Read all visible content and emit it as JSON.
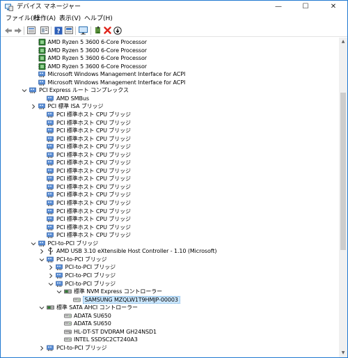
{
  "window": {
    "title": "デバイス マネージャー",
    "controls": {
      "minimize": "—",
      "maximize": "☐",
      "close": "✕"
    }
  },
  "menu": {
    "items": [
      "ファイル(F)",
      "操作(A)",
      "表示(V)",
      "ヘルプ(H)"
    ]
  },
  "toolbar": {
    "buttons": [
      "back-arrow-icon",
      "forward-arrow-icon",
      "device-view-icon",
      "properties-icon",
      "help-icon",
      "show-hidden-icon",
      "monitor-scan-icon",
      "add-driver-icon",
      "uninstall-icon",
      "disable-icon"
    ]
  },
  "tree": {
    "rows": [
      {
        "label": "AMD Ryzen 5 3600 6-Core Processor",
        "icon": "cpu-icon",
        "expander": "none",
        "depth": 3
      },
      {
        "label": "AMD Ryzen 5 3600 6-Core Processor",
        "icon": "cpu-icon",
        "expander": "none",
        "depth": 3
      },
      {
        "label": "AMD Ryzen 5 3600 6-Core Processor",
        "icon": "cpu-icon",
        "expander": "none",
        "depth": 3
      },
      {
        "label": "AMD Ryzen 5 3600 6-Core Processor",
        "icon": "cpu-icon",
        "expander": "none",
        "depth": 3
      },
      {
        "label": "Microsoft Windows Management Interface for ACPI",
        "icon": "system-device-icon",
        "expander": "none",
        "depth": 3
      },
      {
        "label": "Microsoft Windows Management Interface for ACPI",
        "icon": "system-device-icon",
        "expander": "none",
        "depth": 3
      },
      {
        "label": "PCI Express ルート コンプレックス",
        "icon": "system-device-icon",
        "expander": "open",
        "depth": 2
      },
      {
        "label": "AMD SMBus",
        "icon": "system-device-icon",
        "expander": "none",
        "depth": 4
      },
      {
        "label": "PCI 標準 ISA ブリッジ",
        "icon": "system-device-icon",
        "expander": "closed",
        "depth": 3
      },
      {
        "label": "PCI 標準ホスト CPU ブリッジ",
        "icon": "system-device-icon",
        "expander": "none",
        "depth": 4
      },
      {
        "label": "PCI 標準ホスト CPU ブリッジ",
        "icon": "system-device-icon",
        "expander": "none",
        "depth": 4
      },
      {
        "label": "PCI 標準ホスト CPU ブリッジ",
        "icon": "system-device-icon",
        "expander": "none",
        "depth": 4
      },
      {
        "label": "PCI 標準ホスト CPU ブリッジ",
        "icon": "system-device-icon",
        "expander": "none",
        "depth": 4
      },
      {
        "label": "PCI 標準ホスト CPU ブリッジ",
        "icon": "system-device-icon",
        "expander": "none",
        "depth": 4
      },
      {
        "label": "PCI 標準ホスト CPU ブリッジ",
        "icon": "system-device-icon",
        "expander": "none",
        "depth": 4
      },
      {
        "label": "PCI 標準ホスト CPU ブリッジ",
        "icon": "system-device-icon",
        "expander": "none",
        "depth": 4
      },
      {
        "label": "PCI 標準ホスト CPU ブリッジ",
        "icon": "system-device-icon",
        "expander": "none",
        "depth": 4
      },
      {
        "label": "PCI 標準ホスト CPU ブリッジ",
        "icon": "system-device-icon",
        "expander": "none",
        "depth": 4
      },
      {
        "label": "PCI 標準ホスト CPU ブリッジ",
        "icon": "system-device-icon",
        "expander": "none",
        "depth": 4
      },
      {
        "label": "PCI 標準ホスト CPU ブリッジ",
        "icon": "system-device-icon",
        "expander": "none",
        "depth": 4
      },
      {
        "label": "PCI 標準ホスト CPU ブリッジ",
        "icon": "system-device-icon",
        "expander": "none",
        "depth": 4
      },
      {
        "label": "PCI 標準ホスト CPU ブリッジ",
        "icon": "system-device-icon",
        "expander": "none",
        "depth": 4
      },
      {
        "label": "PCI 標準ホスト CPU ブリッジ",
        "icon": "system-device-icon",
        "expander": "none",
        "depth": 4
      },
      {
        "label": "PCI 標準ホスト CPU ブリッジ",
        "icon": "system-device-icon",
        "expander": "none",
        "depth": 4
      },
      {
        "label": "PCI 標準ホスト CPU ブリッジ",
        "icon": "system-device-icon",
        "expander": "none",
        "depth": 4
      },
      {
        "label": "PCI-to-PCI ブリッジ",
        "icon": "system-device-icon",
        "expander": "open",
        "depth": 3
      },
      {
        "label": "AMD USB 3.10 eXtensible Host Controller - 1.10 (Microsoft)",
        "icon": "usb-icon",
        "expander": "closed",
        "depth": 4
      },
      {
        "label": "PCI-to-PCI ブリッジ",
        "icon": "system-device-icon",
        "expander": "open",
        "depth": 4
      },
      {
        "label": "PCI-to-PCI ブリッジ",
        "icon": "system-device-icon",
        "expander": "closed",
        "depth": 5
      },
      {
        "label": "PCI-to-PCI ブリッジ",
        "icon": "system-device-icon",
        "expander": "closed",
        "depth": 5
      },
      {
        "label": "PCI-to-PCI ブリッジ",
        "icon": "system-device-icon",
        "expander": "open",
        "depth": 5
      },
      {
        "label": "標準 NVM Express コントローラー",
        "icon": "storage-controller-icon",
        "expander": "open",
        "depth": 6
      },
      {
        "label": "SAMSUNG MZQLW1T9HMJP-00003",
        "icon": "disk-drive-icon",
        "expander": "none",
        "depth": 7,
        "selected": true
      },
      {
        "label": "標準 SATA AHCI コントローラー",
        "icon": "storage-controller-icon",
        "expander": "open",
        "depth": 4
      },
      {
        "label": "ADATA SU650",
        "icon": "disk-drive-icon",
        "expander": "none",
        "depth": 6
      },
      {
        "label": "ADATA SU650",
        "icon": "disk-drive-icon",
        "expander": "none",
        "depth": 6
      },
      {
        "label": "HL-DT-ST DVDRAM GH24NSD1",
        "icon": "dvd-drive-icon",
        "expander": "none",
        "depth": 6
      },
      {
        "label": "INTEL SSDSC2CT240A3",
        "icon": "disk-drive-icon",
        "expander": "none",
        "depth": 6
      },
      {
        "label": "PCI-to-PCI ブリッジ",
        "icon": "system-device-icon",
        "expander": "closed",
        "depth": 4
      }
    ]
  },
  "scrollbar": {
    "position_fraction": 0.18,
    "visible_fraction": 0.49
  },
  "colors": {
    "selection": "#cce8ff",
    "window_border": "#1f78d1",
    "tree_line": "#a0a0a0",
    "chip_green": "#2e7d32",
    "chip_blue": "#1565c0"
  }
}
